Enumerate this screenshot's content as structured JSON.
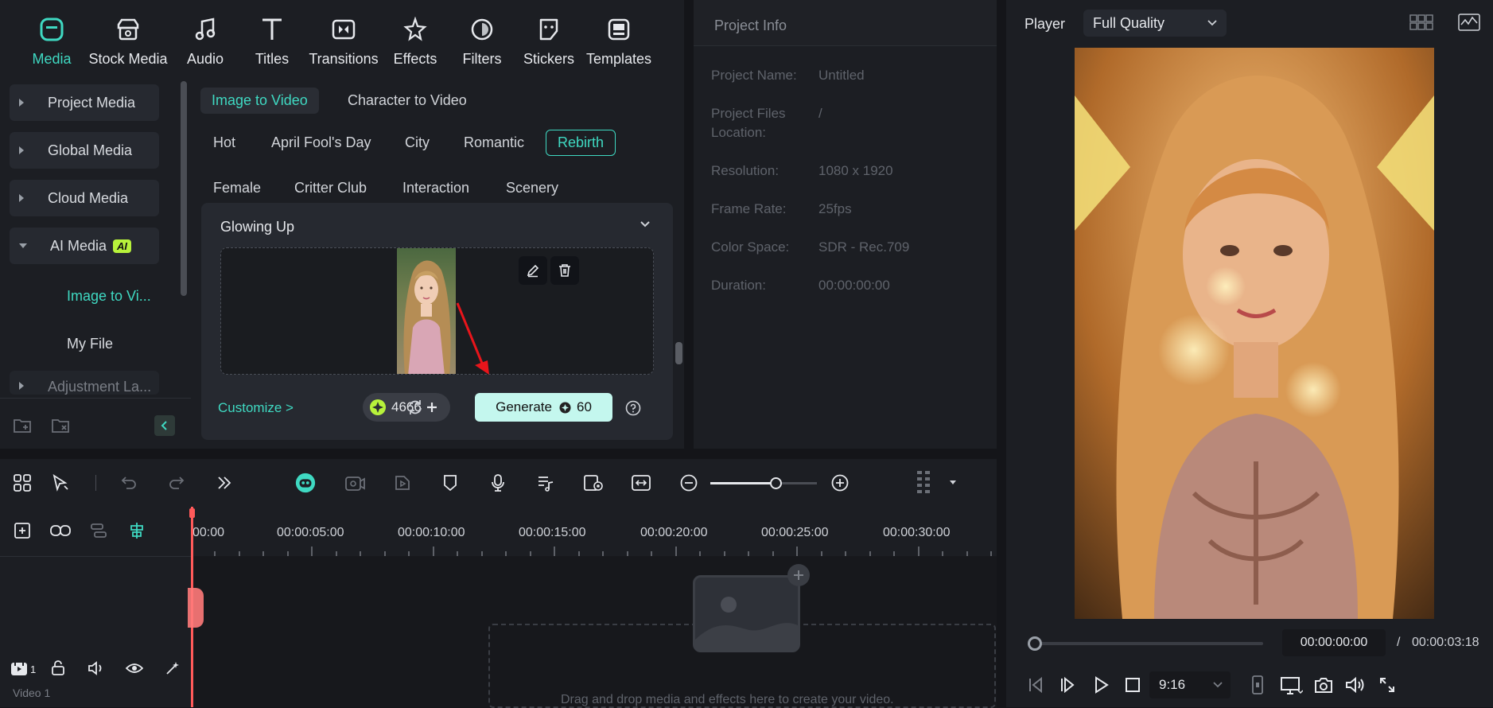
{
  "toolbar": {
    "items": [
      {
        "label": "Media",
        "icon": "media-icon"
      },
      {
        "label": "Stock Media",
        "icon": "stock-media-icon"
      },
      {
        "label": "Audio",
        "icon": "audio-icon"
      },
      {
        "label": "Titles",
        "icon": "titles-icon"
      },
      {
        "label": "Transitions",
        "icon": "transitions-icon"
      },
      {
        "label": "Effects",
        "icon": "effects-icon"
      },
      {
        "label": "Filters",
        "icon": "filters-icon"
      },
      {
        "label": "Stickers",
        "icon": "stickers-icon"
      },
      {
        "label": "Templates",
        "icon": "templates-icon"
      }
    ],
    "active": "Media",
    "accent": "#3fd9c2"
  },
  "sidebar": {
    "items": [
      {
        "label": "Project Media"
      },
      {
        "label": "Global Media"
      },
      {
        "label": "Cloud Media"
      },
      {
        "label": "AI Media",
        "badge": "AI"
      }
    ],
    "subitems": [
      {
        "label": "Image to Vi..."
      },
      {
        "label": "My File"
      }
    ],
    "cut_item": "Adjustment La..."
  },
  "center": {
    "tabs": [
      "Image to Video",
      "Character to Video"
    ],
    "tags_row1": [
      "Hot",
      "April Fool's Day",
      "City",
      "Romantic",
      "Rebirth"
    ],
    "tags_row2": [
      "Female",
      "Critter Club",
      "Interaction",
      "Scenery"
    ],
    "selected_tag": "Rebirth",
    "card_title": "Glowing Up",
    "customize": "Customize >",
    "credits": "4666",
    "generate_label": "Generate",
    "generate_cost": "60"
  },
  "project_info": {
    "title": "Project Info",
    "rows": [
      {
        "label": "Project Name:",
        "value": "Untitled"
      },
      {
        "label": "Project Files",
        "label2": "Location:",
        "value": "/"
      },
      {
        "label": "Resolution:",
        "value": "1080 x 1920"
      },
      {
        "label": "Frame Rate:",
        "value": "25fps"
      },
      {
        "label": "Color Space:",
        "value": "SDR - Rec.709"
      },
      {
        "label": "Duration:",
        "value": "00:00:00:00"
      }
    ]
  },
  "player": {
    "label": "Player",
    "quality": "Full Quality",
    "current_time": "00:00:00:00",
    "separator": "/",
    "total_time": "00:00:03:18",
    "aspect": "9:16",
    "progress": 0
  },
  "timeline": {
    "ticks": [
      "00:00",
      "00:00:05:00",
      "00:00:10:00",
      "00:00:15:00",
      "00:00:20:00",
      "00:00:25:00",
      "00:00:30:00"
    ],
    "track_num": "1",
    "track_name": "Video 1",
    "drop_hint": "Drag and drop media and effects here to create your video."
  }
}
